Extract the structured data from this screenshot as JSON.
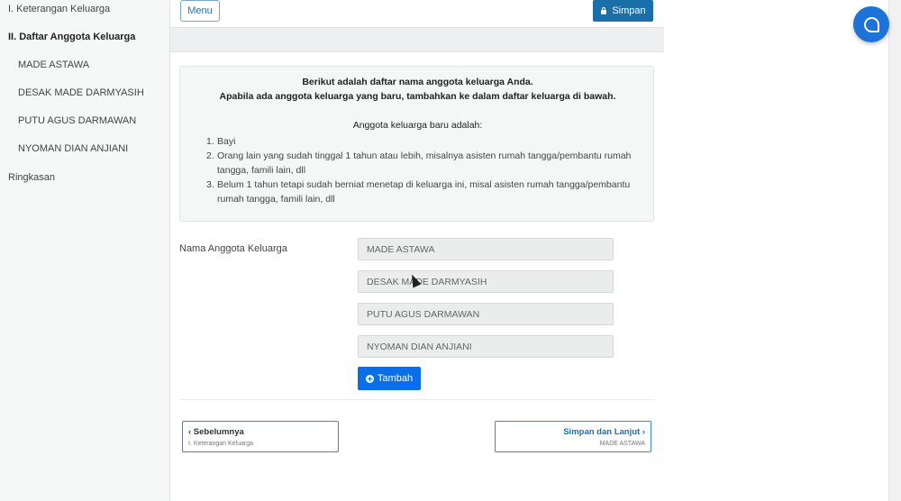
{
  "sidebar": {
    "items": [
      {
        "label": "I. Keterangan Keluarga"
      },
      {
        "label": "II. Daftar Anggota Keluarga"
      },
      {
        "label": "MADE ASTAWA"
      },
      {
        "label": "DESAK MADE DARMYASIH"
      },
      {
        "label": "PUTU AGUS DARMAWAN"
      },
      {
        "label": "NYOMAN DIAN ANJIANI"
      },
      {
        "label": "Ringkasan"
      }
    ]
  },
  "toolbar": {
    "menu_label": "Menu",
    "save_label": "Simpan",
    "save_icon": "lock-icon"
  },
  "info": {
    "line1": "Berikut adalah daftar nama anggota keluarga Anda.",
    "line2": "Apabila ada anggota keluarga yang baru, tambahkan ke dalam daftar keluarga di bawah.",
    "line3": "Anggota keluarga baru adalah:",
    "list": [
      {
        "num": "1.",
        "text": "Bayi"
      },
      {
        "num": "2.",
        "text": "Orang lain yang sudah tinggal 1 tahun atau lebih, misalnya asisten rumah tangga/pembantu rumah tangga, famili lain, dll"
      },
      {
        "num": "3.",
        "text": "Belum 1 tahun tetapi sudah berniat menetap di keluarga ini, misal asisten rumah tangga/pembantu rumah tangga, famili lain, dll"
      }
    ]
  },
  "form": {
    "label": "Nama Anggota Keluarga",
    "members": [
      "MADE ASTAWA",
      "DESAK MADE DARMYASIH",
      "PUTU AGUS DARMAWAN",
      "NYOMAN DIAN ANJIANI"
    ],
    "add_label": "Tambah"
  },
  "nav": {
    "prev_title": "‹ Sebelumnya",
    "prev_sub": "I. Keterangan Keluarga",
    "next_title": "Simpan dan Lanjut ›",
    "next_sub": "MADE ASTAWA"
  },
  "colors": {
    "primary": "#1b6fa8",
    "add_button": "#0a6ee8",
    "chat_fab": "#1e73d8"
  }
}
